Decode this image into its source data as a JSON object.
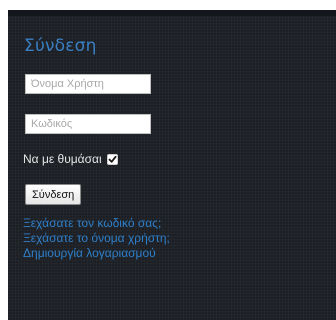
{
  "login": {
    "title": "Σύνδεση",
    "username_placeholder": "Όνομα Χρήστη",
    "password_placeholder": "Κωδικός",
    "remember_label": "Να με θυμάσαι",
    "remember_checked": true,
    "submit_label": "Σύνδεση",
    "links": [
      "Ξεχάσατε τον κωδικό σας;",
      "Ξεχάσατε το όνομα χρήστη;",
      "Δημιουργία λογαριασμού"
    ]
  },
  "colors": {
    "panel_bg": "#1c2026",
    "accent": "#3a7fc4",
    "link": "#2f7fca",
    "text": "#e6e6e6"
  },
  "icons": {
    "checkbox_mark": "checkmark-icon"
  }
}
